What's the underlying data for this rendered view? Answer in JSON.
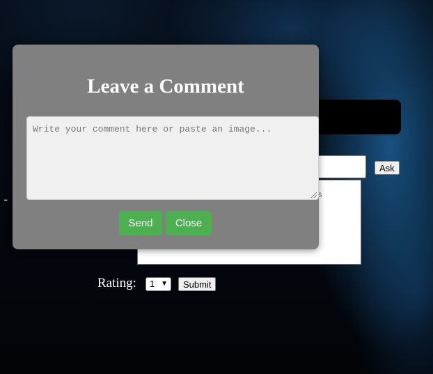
{
  "background": {
    "accent": "#1e8cdc"
  },
  "main": {
    "ask_label": "Ask",
    "answer_fragment": "s",
    "left_glyph": ") -"
  },
  "rating": {
    "label": "Rating:",
    "selected": "1",
    "submit_label": "Submit"
  },
  "modal": {
    "title": "Leave a Comment",
    "comment_placeholder": "Write your comment here or paste an image...",
    "send_label": "Send",
    "close_label": "Close",
    "button_color": "#4caf50"
  }
}
